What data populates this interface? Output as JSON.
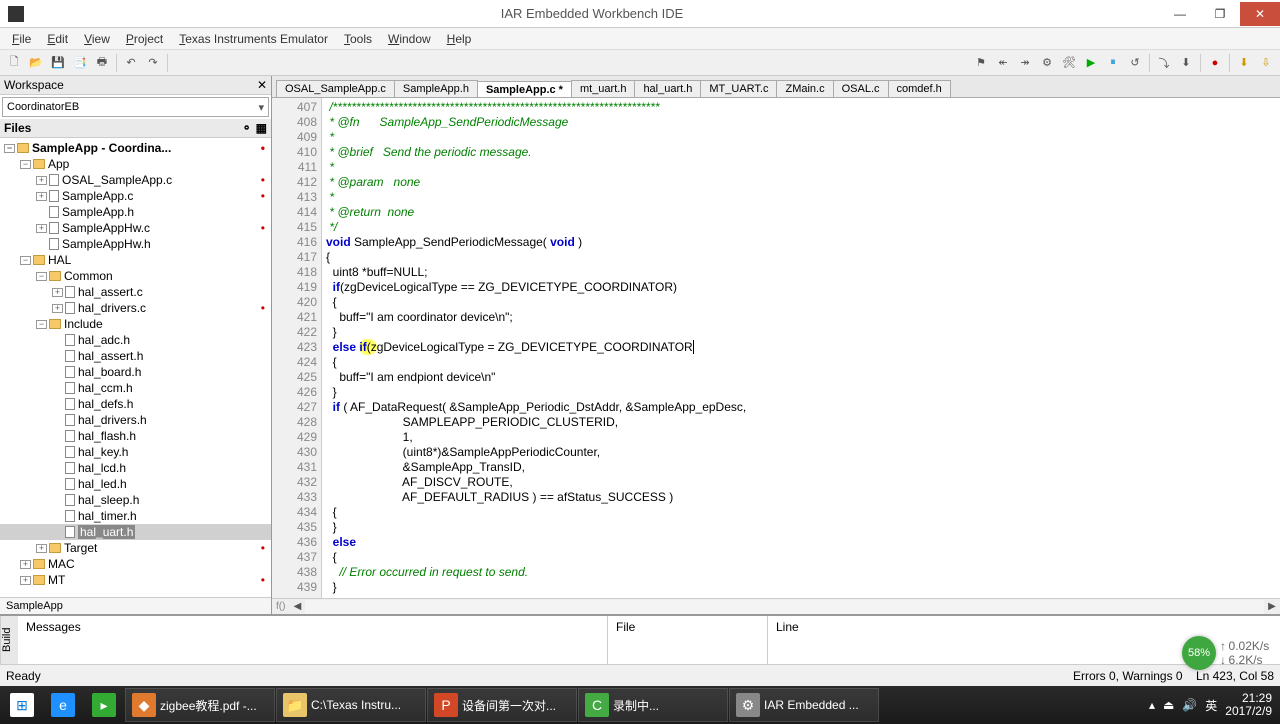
{
  "window": {
    "title": "IAR Embedded Workbench IDE"
  },
  "menus": [
    "File",
    "Edit",
    "View",
    "Project",
    "Texas Instruments Emulator",
    "Tools",
    "Window",
    "Help"
  ],
  "workspace": {
    "panel_title": "Workspace",
    "config": "CoordinatorEB",
    "header": "Files",
    "footer": "SampleApp",
    "tree": [
      {
        "ind": 0,
        "tog": "−",
        "ic": "folder",
        "lbl": "SampleApp - Coordina...",
        "bold": true,
        "mod": true
      },
      {
        "ind": 1,
        "tog": "−",
        "ic": "folder",
        "lbl": "App"
      },
      {
        "ind": 2,
        "tog": "+",
        "ic": "file",
        "lbl": "OSAL_SampleApp.c",
        "mod": true
      },
      {
        "ind": 2,
        "tog": "+",
        "ic": "file",
        "lbl": "SampleApp.c",
        "mod": true
      },
      {
        "ind": 2,
        "tog": "",
        "ic": "file",
        "lbl": "SampleApp.h"
      },
      {
        "ind": 2,
        "tog": "+",
        "ic": "file",
        "lbl": "SampleAppHw.c",
        "mod": true
      },
      {
        "ind": 2,
        "tog": "",
        "ic": "file",
        "lbl": "SampleAppHw.h"
      },
      {
        "ind": 1,
        "tog": "−",
        "ic": "folder",
        "lbl": "HAL"
      },
      {
        "ind": 2,
        "tog": "−",
        "ic": "folder",
        "lbl": "Common"
      },
      {
        "ind": 3,
        "tog": "+",
        "ic": "file",
        "lbl": "hal_assert.c"
      },
      {
        "ind": 3,
        "tog": "+",
        "ic": "file",
        "lbl": "hal_drivers.c",
        "mod": true
      },
      {
        "ind": 2,
        "tog": "−",
        "ic": "folder",
        "lbl": "Include"
      },
      {
        "ind": 3,
        "tog": "",
        "ic": "file",
        "lbl": "hal_adc.h"
      },
      {
        "ind": 3,
        "tog": "",
        "ic": "file",
        "lbl": "hal_assert.h"
      },
      {
        "ind": 3,
        "tog": "",
        "ic": "file",
        "lbl": "hal_board.h"
      },
      {
        "ind": 3,
        "tog": "",
        "ic": "file",
        "lbl": "hal_ccm.h"
      },
      {
        "ind": 3,
        "tog": "",
        "ic": "file",
        "lbl": "hal_defs.h"
      },
      {
        "ind": 3,
        "tog": "",
        "ic": "file",
        "lbl": "hal_drivers.h"
      },
      {
        "ind": 3,
        "tog": "",
        "ic": "file",
        "lbl": "hal_flash.h"
      },
      {
        "ind": 3,
        "tog": "",
        "ic": "file",
        "lbl": "hal_key.h"
      },
      {
        "ind": 3,
        "tog": "",
        "ic": "file",
        "lbl": "hal_lcd.h"
      },
      {
        "ind": 3,
        "tog": "",
        "ic": "file",
        "lbl": "hal_led.h"
      },
      {
        "ind": 3,
        "tog": "",
        "ic": "file",
        "lbl": "hal_sleep.h"
      },
      {
        "ind": 3,
        "tog": "",
        "ic": "file",
        "lbl": "hal_timer.h"
      },
      {
        "ind": 3,
        "tog": "",
        "ic": "file",
        "lbl": "hal_uart.h",
        "sel": true
      },
      {
        "ind": 2,
        "tog": "+",
        "ic": "folder",
        "lbl": "Target",
        "mod": true
      },
      {
        "ind": 1,
        "tog": "+",
        "ic": "folder",
        "lbl": "MAC"
      },
      {
        "ind": 1,
        "tog": "+",
        "ic": "folder",
        "lbl": "MT",
        "mod": true
      }
    ]
  },
  "editor": {
    "tabs": [
      "OSAL_SampleApp.c",
      "SampleApp.h",
      "SampleApp.c *",
      "mt_uart.h",
      "hal_uart.h",
      "MT_UART.c",
      "ZMain.c",
      "OSAL.c",
      "comdef.h"
    ],
    "active_tab": 2,
    "lines": [
      {
        "n": 407,
        "h": " /**********************************************************************",
        "c": "cmt"
      },
      {
        "n": 408,
        "h": " * @fn      SampleApp_SendPeriodicMessage",
        "c": "cmt"
      },
      {
        "n": 409,
        "h": " *",
        "c": "cmt"
      },
      {
        "n": 410,
        "h": " * @brief   Send the periodic message.",
        "c": "cmt"
      },
      {
        "n": 411,
        "h": " *",
        "c": "cmt"
      },
      {
        "n": 412,
        "h": " * @param   none",
        "c": "cmt"
      },
      {
        "n": 413,
        "h": " *",
        "c": "cmt"
      },
      {
        "n": 414,
        "h": " * @return  none",
        "c": "cmt"
      },
      {
        "n": 415,
        "h": " */",
        "c": "cmt"
      },
      {
        "n": 416,
        "h": "<span class='kw'>void</span> SampleApp_SendPeriodicMessage( <span class='kw'>void</span> )"
      },
      {
        "n": 417,
        "h": "{"
      },
      {
        "n": 418,
        "h": "  uint8 *buff=NULL;"
      },
      {
        "n": 419,
        "h": "  <span class='kw'>if</span>(zgDeviceLogicalType == ZG_DEVICETYPE_COORDINATOR)"
      },
      {
        "n": 420,
        "h": "  {"
      },
      {
        "n": 421,
        "h": "    buff=\"I am coordinator device\\n\";"
      },
      {
        "n": 422,
        "h": "  }"
      },
      {
        "n": 423,
        "h": "  <span class='kw'>else</span> <span class='hl'><span class='kw'>if</span>(z</span>gDeviceLogicalType = ZG_DEVICETYPE_COORDINATOR<span class='cursor'></span>"
      },
      {
        "n": 424,
        "h": "  {"
      },
      {
        "n": 425,
        "h": "    buff=\"I am endpiont device\\n\""
      },
      {
        "n": 426,
        "h": "  }"
      },
      {
        "n": 427,
        "h": "  <span class='kw'>if</span> ( AF_DataRequest( &SampleApp_Periodic_DstAddr, &SampleApp_epDesc,"
      },
      {
        "n": 428,
        "h": "                       SAMPLEAPP_PERIODIC_CLUSTERID,"
      },
      {
        "n": 429,
        "h": "                       1,"
      },
      {
        "n": 430,
        "h": "                       (uint8*)&SampleAppPeriodicCounter,"
      },
      {
        "n": 431,
        "h": "                       &SampleApp_TransID,"
      },
      {
        "n": 432,
        "h": "                       AF_DISCV_ROUTE,"
      },
      {
        "n": 433,
        "h": "                       AF_DEFAULT_RADIUS ) == afStatus_SUCCESS )"
      },
      {
        "n": 434,
        "h": "  {"
      },
      {
        "n": 435,
        "h": "  }"
      },
      {
        "n": 436,
        "h": "  <span class='kw'>else</span>"
      },
      {
        "n": 437,
        "h": "  {"
      },
      {
        "n": 438,
        "h": "    <span class='cmt'>// Error occurred in request to send.</span>"
      },
      {
        "n": 439,
        "h": "  }"
      }
    ]
  },
  "build_panel": {
    "edge": "Build",
    "col1": "Messages",
    "col2": "File",
    "col3": "Line"
  },
  "speed": {
    "pct": "58%",
    "up": "0.02K/s",
    "down": "6.2K/s"
  },
  "status": {
    "left": "Ready",
    "errors": "Errors 0, Warnings 0",
    "pos": "Ln 423, Col 58"
  },
  "taskbar": {
    "items": [
      {
        "lbl": "zigbee教程.pdf -..."
      },
      {
        "lbl": "C:\\Texas Instru..."
      },
      {
        "lbl": "设备间第一次对..."
      },
      {
        "lbl": "录制中..."
      },
      {
        "lbl": "IAR Embedded ..."
      }
    ],
    "ime": "英",
    "time": "21:29",
    "date": "2017/2/9"
  }
}
